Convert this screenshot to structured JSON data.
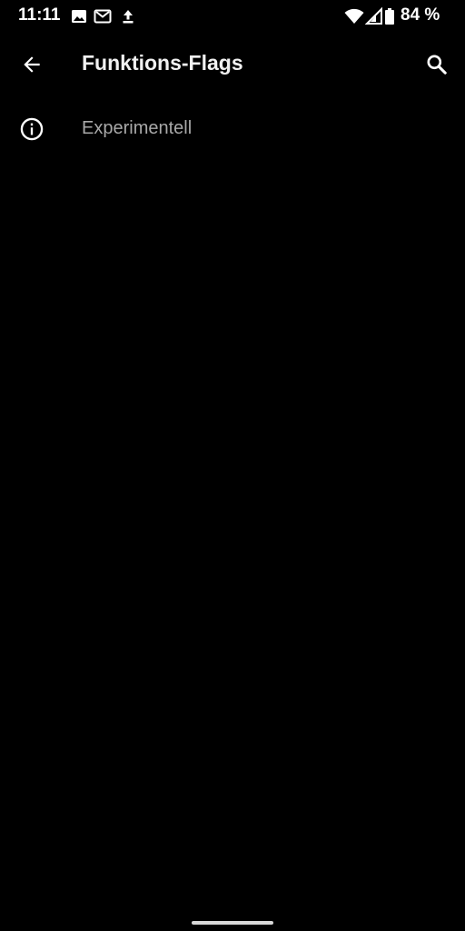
{
  "status_bar": {
    "time": "11:11",
    "battery": "84 %",
    "icons": [
      "image-icon",
      "gmail-icon",
      "upload-icon",
      "wifi-icon",
      "signal-icon",
      "battery-icon"
    ]
  },
  "app_bar": {
    "title": "Funktions-Flags",
    "back_icon": "arrow-back-icon",
    "search_icon": "search-icon"
  },
  "list": {
    "items": [
      {
        "label": "Experimentell",
        "icon": "info-icon"
      }
    ]
  },
  "colors": {
    "background": "#000000",
    "title": "#f1f1f1",
    "item_label": "#a8a8a8",
    "icon": "#ffffff",
    "gesture_bar": "#d8d8d8"
  }
}
